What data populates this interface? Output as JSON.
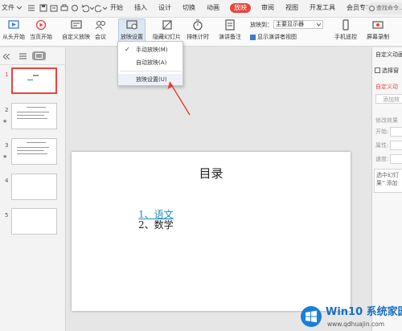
{
  "menubar": {
    "file_label": "文件",
    "tabs": [
      {
        "label": "开始",
        "active": false
      },
      {
        "label": "插入",
        "active": false
      },
      {
        "label": "设计",
        "active": false
      },
      {
        "label": "切换",
        "active": false
      },
      {
        "label": "动画",
        "active": false
      },
      {
        "label": "放映",
        "active": true
      },
      {
        "label": "审阅",
        "active": false
      },
      {
        "label": "视图",
        "active": false
      },
      {
        "label": "开发工具",
        "active": false
      },
      {
        "label": "会员专享",
        "active": false
      }
    ],
    "search_text": "查找命令..."
  },
  "ribbon": {
    "from_start": "从头开始",
    "from_current": "当页开始",
    "custom_show": "自定义放映",
    "meeting": "会议",
    "slideshow_settings": "放映设置",
    "hide_slide": "隐藏幻灯片",
    "rehearse": "排练计时",
    "speaker_notes": "演讲备注",
    "show_on_label": "放映到：",
    "show_on_value": "主要显示器",
    "presenter_view": "显示演讲者视图",
    "phone_remote": "手机遥控",
    "screen_record": "屏幕录制"
  },
  "dropdown": {
    "items": [
      "手动放映(M)",
      "自动放映(A)",
      "放映设置(U)"
    ]
  },
  "thumbnails": {
    "numbers": [
      "1",
      "2",
      "3",
      "4",
      "5"
    ]
  },
  "slide": {
    "title": "目录",
    "item1": "1、语文",
    "item2": "2、数学"
  },
  "rightpane": {
    "title": "自定义动画",
    "select": "选择窗",
    "custom": "自定义动",
    "add": "添加效",
    "modify": "修改效果",
    "start": "开始:",
    "prop": "属性:",
    "speed": "速度:",
    "hint1": "选中幻灯",
    "hint2": "果\" 添加"
  },
  "watermark": {
    "brand": "Win10 系统家园",
    "url": "www.qdhuajin.com"
  },
  "colors": {
    "accent": "#e8453c",
    "link": "#1a8fbf",
    "arrow": "#e23b2e"
  }
}
